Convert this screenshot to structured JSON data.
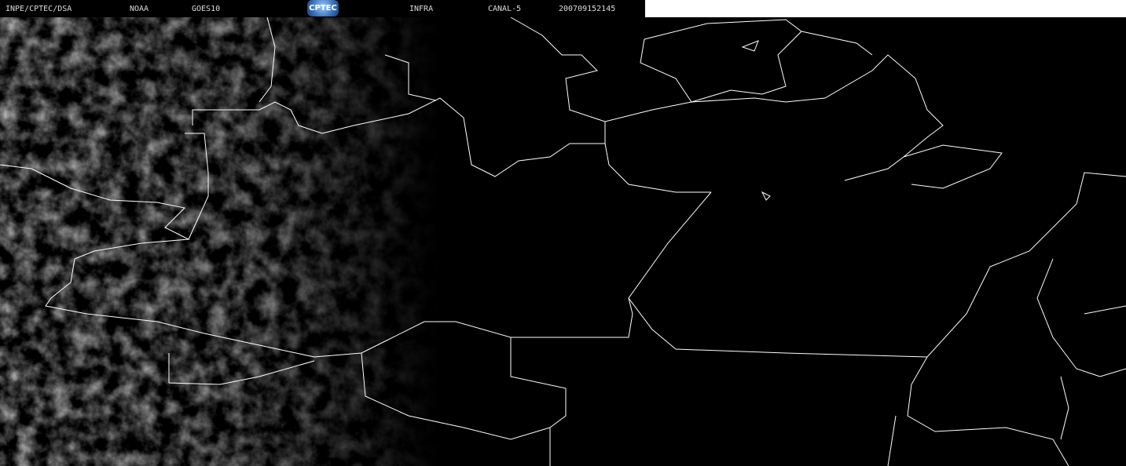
{
  "header": {
    "source": "INPE/CPTEC/DSA",
    "agency": "NOAA",
    "satellite": "GOES10",
    "logo_text": "CPTEC",
    "product": "INFRA",
    "channel": "CANAL-5",
    "datetime": "200709152145"
  }
}
